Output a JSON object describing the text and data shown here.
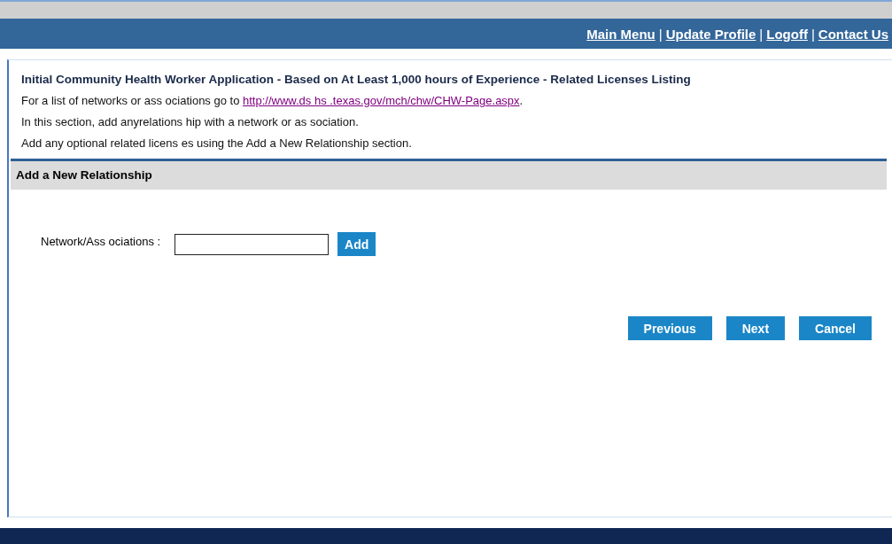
{
  "header_links": [
    {
      "label": "Main Menu"
    },
    {
      "separator": "|",
      "label": "Update Profile"
    },
    {
      "separator": "|",
      "label": "Logoff"
    },
    {
      "separator": "|",
      "label": "Contact Us"
    }
  ],
  "page_title": "Initial Community Health Worker Application - Based on At Least 1,000 hours of Experience - Related Licenses Listing",
  "intro": {
    "text": "For a list of networks or ass ociations go to",
    "link": "http://www.ds hs .texas.gov/mch/chw/CHW-Page.aspx",
    "after": "."
  },
  "notes": [
    "In this section, add anyrelations hip with a network or as sociation.",
    "Add any optional related licens es using the Add a New Relationship section."
  ],
  "section_title": "Add a New Relationship",
  "field": {
    "label": "Network/Ass ociations :"
  },
  "add_button": "Add",
  "buttons": [
    "Previous",
    "Next",
    "Cancel"
  ]
}
